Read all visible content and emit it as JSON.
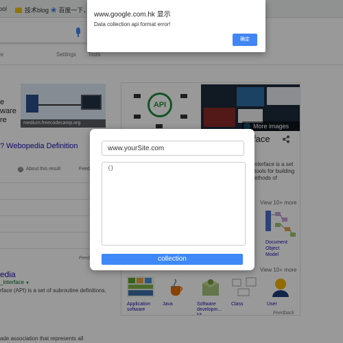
{
  "bookmarks": [
    {
      "label": "ool"
    },
    {
      "label": "技术blog"
    },
    {
      "label": "百度一下，你"
    }
  ],
  "search_tabs": [
    "re",
    "Settings",
    "Tools"
  ],
  "results": {
    "first_text_lines": [
      "e",
      "ware",
      "re"
    ],
    "first_image_caption": "medium.freecodecamp.org",
    "webopedia_title": "? Webopedia Definition",
    "about_label": "About this result",
    "feedback_label": "Feed",
    "feedback_label_2": "Feedb",
    "wiki_title": "edia",
    "wiki_url": "_interface",
    "wiki_snippet": "rface (API) is a set of subroutine definitions,",
    "bottom_snippet": "ade association that represents all"
  },
  "knowledge_panel": {
    "api_badge": "API",
    "more_images": "More images",
    "title": "face",
    "description_lines": [
      "nterface is a set",
      "tools for building",
      "ethods of"
    ],
    "view_more_1": "View 10+ more",
    "doc_label_lines": [
      "Document",
      "Object",
      "Model"
    ],
    "view_more_2": "View 10+ more",
    "people_also": "",
    "items": [
      {
        "label_lines": [
          "Application",
          "software"
        ]
      },
      {
        "label_lines": [
          "Java"
        ]
      },
      {
        "label_lines": [
          "Software",
          "developm...",
          "kit"
        ]
      },
      {
        "label_lines": [
          "Class"
        ]
      },
      {
        "label_lines": [
          "User"
        ]
      }
    ],
    "feedback": "Feedback"
  },
  "alert": {
    "title": "www.google.com.hk 显示",
    "message": "Data collection api format error!",
    "ok_label": "确定"
  },
  "modal": {
    "site_value": "www.yourSite.com",
    "format_value": "{}",
    "collect_label": "collection"
  },
  "colors": {
    "accent": "#4285f4",
    "collect_button": "#3e88f7",
    "link": "#1a0dab",
    "overlay": "rgba(0,0,0,0.4)"
  }
}
